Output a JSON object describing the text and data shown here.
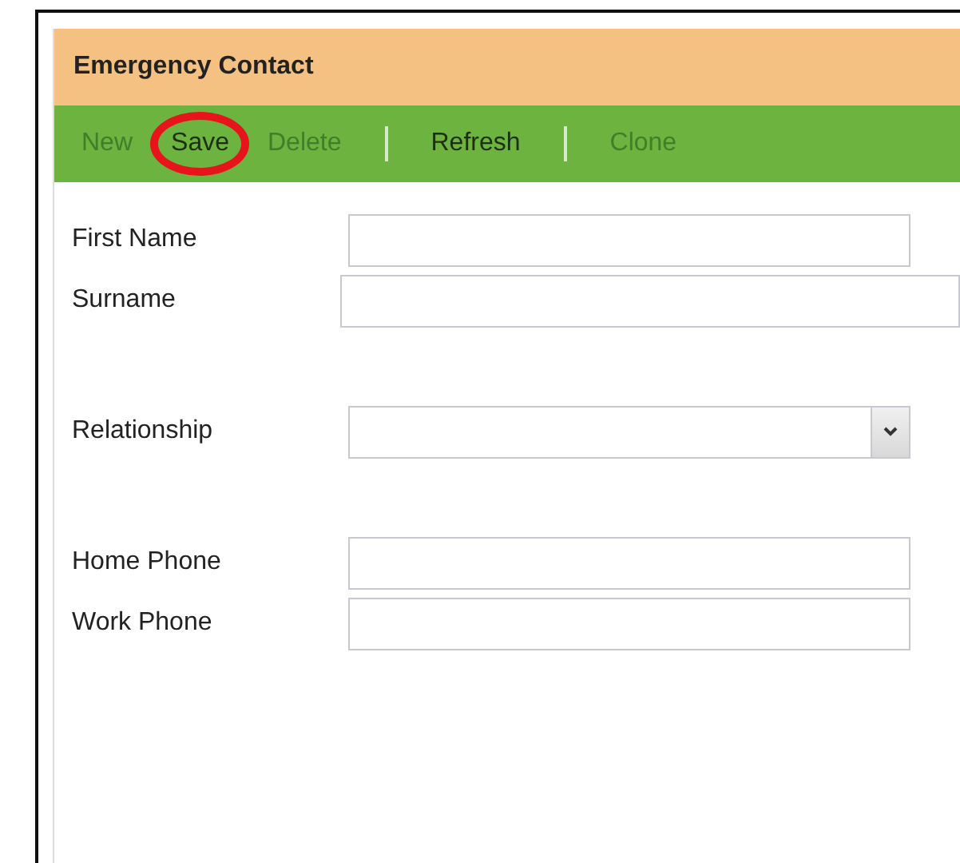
{
  "panel": {
    "title": "Emergency Contact"
  },
  "toolbar": [
    {
      "kind": "action",
      "label": "New",
      "disabled": true,
      "highlighted": false
    },
    {
      "kind": "action",
      "label": "Save",
      "disabled": false,
      "highlighted": true
    },
    {
      "kind": "action",
      "label": "Delete",
      "disabled": true,
      "highlighted": false
    },
    {
      "kind": "separator"
    },
    {
      "kind": "action",
      "label": "Refresh",
      "disabled": false,
      "highlighted": false
    },
    {
      "kind": "separator"
    },
    {
      "kind": "action",
      "label": "Clone",
      "disabled": true,
      "highlighted": false
    }
  ],
  "field_groups": [
    [
      {
        "label": "First Name",
        "kind": "text",
        "wide": false
      },
      {
        "label": "Surname",
        "kind": "text",
        "wide": true
      }
    ],
    [
      {
        "label": "Relationship",
        "kind": "select",
        "wide": false
      }
    ],
    [
      {
        "label": "Home Phone",
        "kind": "text",
        "wide": false
      },
      {
        "label": "Work Phone",
        "kind": "text",
        "wide": false
      }
    ]
  ]
}
